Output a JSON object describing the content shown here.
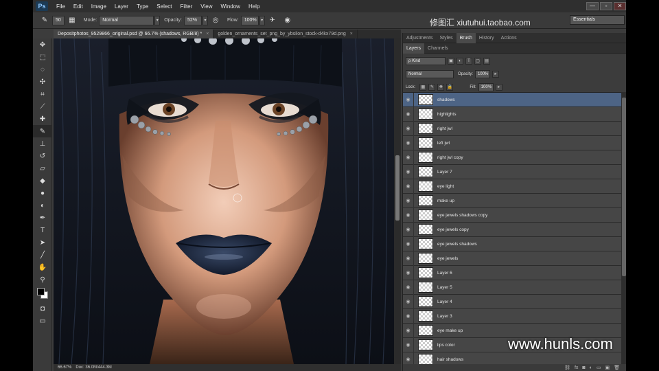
{
  "menu": {
    "logo": "Ps",
    "items": [
      "File",
      "Edit",
      "Image",
      "Layer",
      "Type",
      "Select",
      "Filter",
      "View",
      "Window",
      "Help"
    ]
  },
  "watermark_top": "修图汇  xiutuhui.taobao.com",
  "watermark_bottom": "www.hunls.com",
  "window_buttons": [
    "—",
    "▫",
    "✕"
  ],
  "options": {
    "brush_size": "50",
    "mode_label": "Mode:",
    "mode_value": "Normal",
    "opacity_label": "Opacity:",
    "opacity_value": "52%",
    "flow_label": "Flow:",
    "flow_value": "100%",
    "workspace": "Essentials"
  },
  "documents": {
    "tabs": [
      {
        "label": "Depositphotos_9529866_original.psd @ 66.7% (shadows, RGB/8) *",
        "active": true
      },
      {
        "label": "golden_ornaments_set_png_by_ybsilon_stock-d4kx79d.png",
        "active": false
      }
    ]
  },
  "statusbar": {
    "zoom": "66.67%",
    "doc": "Doc: 36.0M/444.3M"
  },
  "panels": {
    "top_tabs": [
      "Adjustments",
      "Styles",
      "Brush",
      "History",
      "Actions"
    ],
    "active_top": "Brush",
    "layer_tabs": [
      "Layers",
      "Channels"
    ],
    "active_layer_tab": "Layers",
    "kind_label": "ρ Kind",
    "blend_mode": "Normal",
    "opacity_label": "Opacity:",
    "opacity_value": "100%",
    "lock_label": "Lock:",
    "fill_label": "Fill:",
    "fill_value": "100%"
  },
  "layers": [
    "shadows",
    "highlights",
    "right jwl",
    "left jwl",
    "right jwl copy",
    "Layer 7",
    "eye light",
    "make up",
    "eye jewels shadows copy",
    "eye jewels copy",
    "eye jewels shadows",
    "eye jewels",
    "Layer 6",
    "Layer 5",
    "Layer 4",
    "Layer 3",
    "eye make up",
    "lips color",
    "hair shadows"
  ],
  "selected_layer": "shadows",
  "footer_icons": [
    "link-icon",
    "fx-icon",
    "mask-icon",
    "adjustment-icon",
    "folder-icon",
    "new-layer-icon",
    "trash-icon"
  ],
  "colors": {
    "selected_row": "#4d6485",
    "panel_bg": "#3c3c3c",
    "lips": "#1c2a44"
  }
}
